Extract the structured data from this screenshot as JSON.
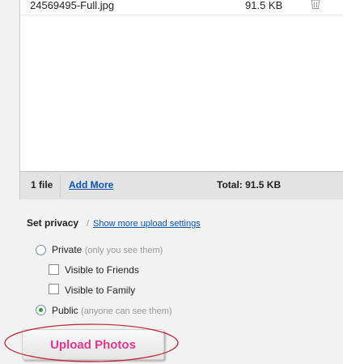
{
  "files": [
    {
      "name": "24569495-Full.jpg",
      "size": "91.5 KB"
    }
  ],
  "summary": {
    "count": "1 file",
    "add_more": "Add More",
    "total": "Total: 91.5 KB"
  },
  "privacy": {
    "heading": "Set privacy",
    "separator": "/",
    "more_link": "Show more upload settings",
    "private": {
      "label": "Private",
      "hint": "(only you see them)",
      "selected": false
    },
    "friends": {
      "label": "Visible to Friends",
      "checked": false
    },
    "family": {
      "label": "Visible to Family",
      "checked": false
    },
    "public": {
      "label": "Public",
      "hint": "(anyone can see them)",
      "selected": true
    }
  },
  "upload_button": {
    "label": "Upload Photos"
  },
  "colors": {
    "link": "#0a53b0",
    "upload_text": "#e6368c",
    "annotation": "#c0202c",
    "radio_selected": "#2f9e3a"
  },
  "icons": {
    "delete": "trash-icon"
  }
}
